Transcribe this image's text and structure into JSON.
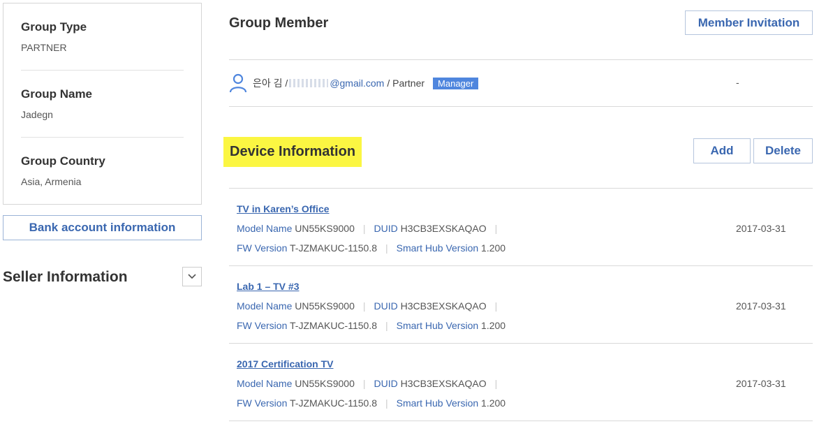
{
  "group": {
    "type_label": "Group Type",
    "type_value": "PARTNER",
    "name_label": "Group Name",
    "name_value": "Jadegn",
    "country_label": "Group Country",
    "country_value": "Asia, Armenia"
  },
  "bank_button": "Bank account information",
  "seller": {
    "title": "Seller Information",
    "toggle_icon": "chevron-down-icon"
  },
  "member_section": {
    "title": "Group Member",
    "invite_button": "Member Invitation",
    "member": {
      "name": "은아 김 /",
      "email_suffix": "@gmail.com",
      "role_text": "/ Partner",
      "badge": "Manager",
      "date": "-"
    }
  },
  "device_section": {
    "title": "Device Information",
    "add_button": "Add",
    "delete_button": "Delete",
    "devices": [
      {
        "name": "TV in Karen’s Office",
        "model_label": "Model Name",
        "model": "UN55KS9000",
        "duid_label": "DUID",
        "duid": "H3CB3EXSKAQAO",
        "fw_label": "FW Version",
        "fw": "T-JZMAKUC-1150.8",
        "hub_label": "Smart Hub Version",
        "hub": "1.200",
        "date": "2017-03-31"
      },
      {
        "name": "Lab 1 – TV #3",
        "model_label": "Model Name",
        "model": "UN55KS9000",
        "duid_label": "DUID",
        "duid": "H3CB3EXSKAQAO",
        "fw_label": "FW Version",
        "fw": "T-JZMAKUC-1150.8",
        "hub_label": "Smart Hub Version",
        "hub": "1.200",
        "date": "2017-03-31"
      },
      {
        "name": "2017 Certification TV",
        "model_label": "Model Name",
        "model": "UN55KS9000",
        "duid_label": "DUID",
        "duid": "H3CB3EXSKAQAO",
        "fw_label": "FW Version",
        "fw": "T-JZMAKUC-1150.8",
        "hub_label": "Smart Hub Version",
        "hub": "1.200",
        "date": "2017-03-31"
      }
    ]
  },
  "colors": {
    "link": "#3a67b0",
    "badge": "#4f86de",
    "highlight": "#fbf642"
  }
}
